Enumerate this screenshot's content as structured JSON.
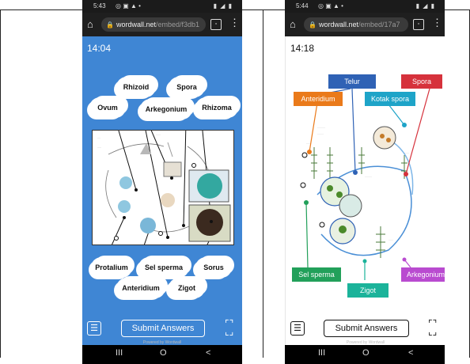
{
  "left_phone": {
    "status_time": "5:43",
    "status_icons": "◎ ▣ ▲ •",
    "status_right": "▮ ◢ ▮",
    "url_host": "wordwall.net",
    "url_path": "/embed/f3db1",
    "timer": "14:04",
    "labels_top": [
      "Rhizoid",
      "Spora",
      "Ovum",
      "Arkegonium",
      "Rhizoma"
    ],
    "labels_bottom": [
      "Protalium",
      "Sel sperma",
      "Sorus",
      "Anteridium",
      "Zigot"
    ],
    "submit_label": "Submit Answers",
    "powered": "Powered by Wordwall",
    "nav": [
      "III",
      "O",
      "<"
    ]
  },
  "right_phone": {
    "status_time": "5:44",
    "status_icons": "◎ ▣ ▲ •",
    "status_right": "▮ ◢ ▮",
    "url_host": "wordwall.net",
    "url_path": "/embed/17a7",
    "timer": "14:18",
    "labels": {
      "telur": "Telur",
      "spora": "Spora",
      "anteridium": "Anteridium",
      "kotak_spora": "Kotak spora",
      "sel_sperma": "Sel sperma",
      "arkegonium": "Arkegonium",
      "zigot": "Zigot"
    },
    "colors": {
      "telur": "#2f62b5",
      "spora": "#d6323c",
      "anteridium": "#ea7a1a",
      "kotak_spora": "#1ea4c8",
      "sel_sperma": "#22a05a",
      "arkegonium": "#b94bd0",
      "zigot": "#1bb39a"
    },
    "submit_label": "Submit Answers",
    "powered": "Powered by Wordwall",
    "nav": [
      "III",
      "O",
      "<"
    ]
  }
}
